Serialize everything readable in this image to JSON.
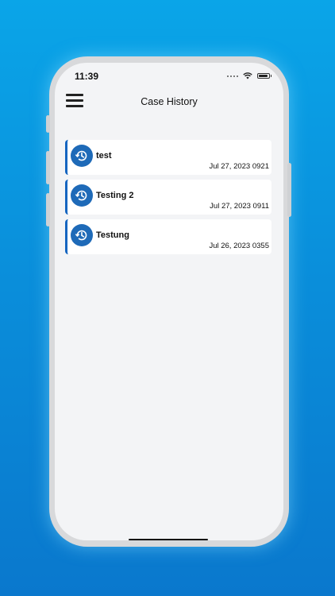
{
  "status_bar": {
    "time": "11:39"
  },
  "header": {
    "title": "Case History",
    "menu_icon": "hamburger-menu-icon"
  },
  "cases": [
    {
      "name": "test",
      "date": "Jul 27, 2023 0921",
      "icon": "history-icon"
    },
    {
      "name": "Testing 2",
      "date": "Jul 27, 2023 0911",
      "icon": "history-icon"
    },
    {
      "name": "Testung",
      "date": "Jul 26, 2023 0355",
      "icon": "history-icon"
    }
  ],
  "colors": {
    "accent": "#1565c0",
    "icon_bg": "#1e6ab8",
    "screen_bg": "#f3f4f6",
    "page_bg": "#0a8fdb"
  }
}
